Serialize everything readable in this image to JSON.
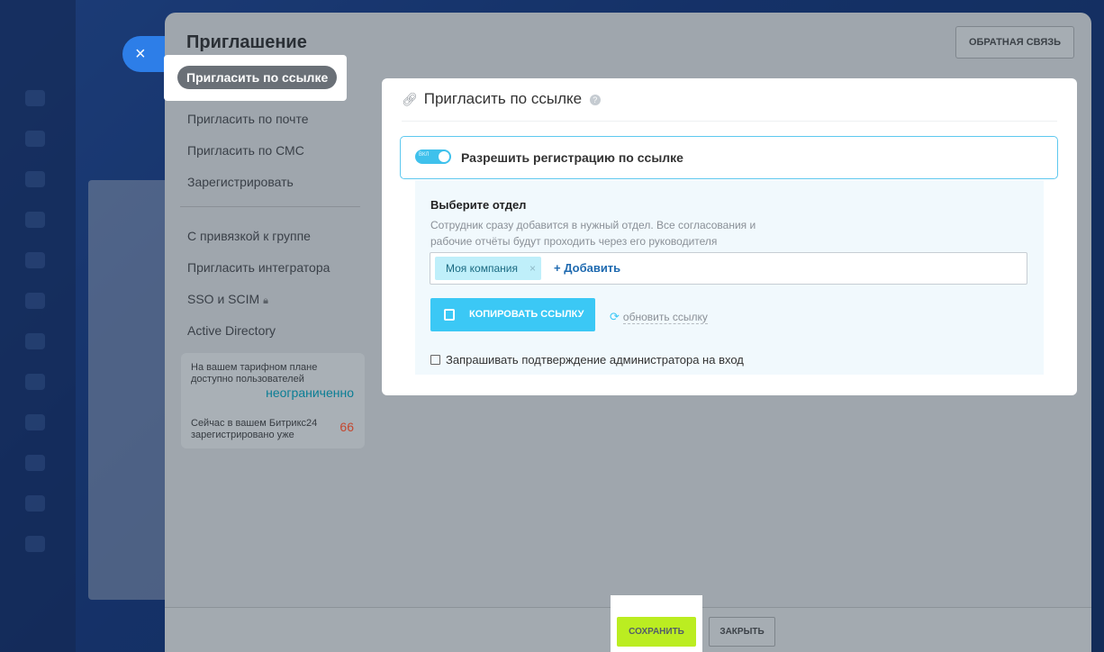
{
  "slider": {
    "title": "Приглашение",
    "feedback_label": "ОБРАТНАЯ СВЯЗЬ",
    "close_icon": "×"
  },
  "nav": {
    "active": "Пригласить по ссылке",
    "items_top": [
      "Пригласить по почте",
      "Пригласить по СМС",
      "Зарегистрировать"
    ],
    "items_bottom": [
      "С привязкой к группе",
      "Пригласить интегратора",
      "SSO и SCIM",
      "Active Directory"
    ]
  },
  "info": {
    "plan_text": "На вашем тарифном плане доступно пользователей",
    "plan_value": "неограниченно",
    "registered_text": "Сейчас в вашем Битрикс24 зарегистрировано уже",
    "registered_value": "66"
  },
  "card": {
    "title": "Пригласить по ссылке",
    "toggle_text": "ВКЛ",
    "toggle_label": "Разрешить регистрацию по ссылке",
    "dept_title": "Выберите отдел",
    "dept_desc": "Сотрудник сразу добавится в нужный отдел. Все согласования и рабочие отчёты будут проходить через его руководителя",
    "chip_label": "Моя компания",
    "add_label": "+ Добавить",
    "copy_label": "КОПИРОВАТЬ ССЫЛКУ",
    "refresh_label": "обновить ссылку",
    "admin_confirm_label": "Запрашивать подтверждение администратора на вход"
  },
  "footer": {
    "save_label": "СОХРАНИТЬ",
    "close_label": "ЗАКРЫТЬ"
  },
  "colors": {
    "accent": "#3bc8f5",
    "save": "#bbed21",
    "link": "#1f6ab0",
    "count": "#c4472f"
  }
}
